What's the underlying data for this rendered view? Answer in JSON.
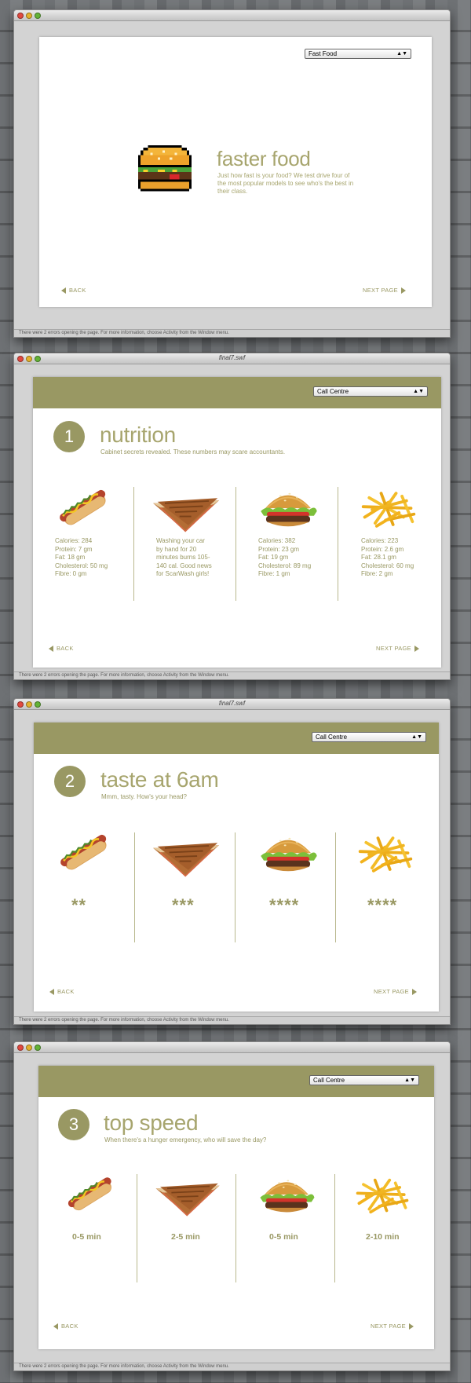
{
  "status_text": "There were 2 errors opening the page. For more information, choose Activity from the Window menu.",
  "window_title": "final7.swf",
  "colors": {
    "accent": "#999863",
    "accent_light": "#a7a56e"
  },
  "screen1": {
    "select_value": "Fast Food",
    "title": "faster food",
    "description": "Just how fast is your food? We test drive four of the most popular models to see who's the best in their class.",
    "back": "BACK",
    "next": "NEXT PAGE",
    "icon": "pixel-burger-icon"
  },
  "screen2": {
    "select_value": "Call Centre",
    "number": "1",
    "title": "nutrition",
    "subtitle": "Cabinet secrets revealed. These numbers may scare accountants.",
    "back": "BACK",
    "next": "NEXT PAGE",
    "items": [
      {
        "food": "hotdog",
        "lines": [
          "Calories: 284",
          "Protein: 7 gm",
          "Fat: 18 gm",
          "Cholesterol: 50 mg",
          "Fibre: 0 gm"
        ]
      },
      {
        "food": "toastie",
        "lines": [
          "Washing your car",
          "by hand for 20",
          "minutes burns 105-",
          "140 cal. Good news",
          "for ScarWash girls!"
        ]
      },
      {
        "food": "burger",
        "lines": [
          "Calories: 382",
          "Protein: 23 gm",
          "Fat: 19 gm",
          "Cholesterol: 89 mg",
          "Fibre: 1 gm"
        ]
      },
      {
        "food": "fries",
        "lines": [
          "Calories: 223",
          "Protein: 2.6 gm",
          "Fat: 28.1 gm",
          "Cholesterol: 60 mg",
          "Fibre: 2 gm"
        ]
      }
    ]
  },
  "screen3": {
    "select_value": "Call Centre",
    "number": "2",
    "title": "taste at 6am",
    "subtitle": "Mmm, tasty. How's your head?",
    "back": "BACK",
    "next": "NEXT PAGE",
    "ratings": [
      "**",
      "***",
      "****",
      "****"
    ]
  },
  "screen4": {
    "select_value": "Call Centre",
    "number": "3",
    "title": "top speed",
    "subtitle": "When there's a hunger emergency, who will save the day?",
    "back": "BACK",
    "next": "NEXT PAGE",
    "speeds": [
      "0-5 min",
      "2-5 min",
      "0-5 min",
      "2-10 min"
    ]
  }
}
